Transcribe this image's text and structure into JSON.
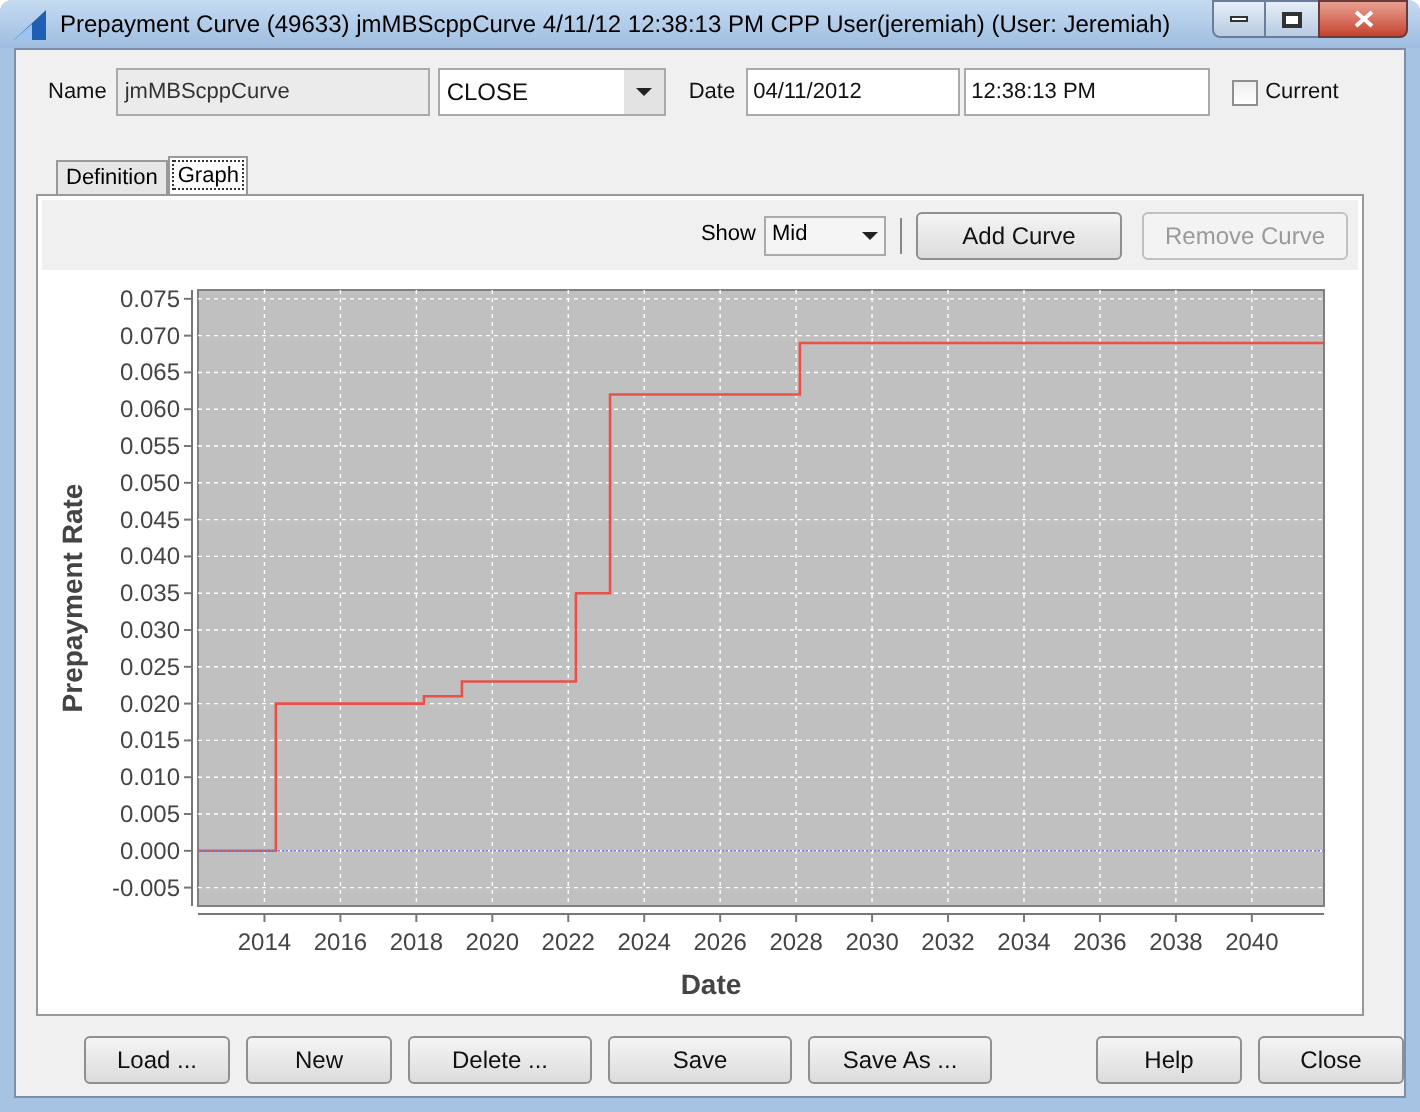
{
  "window": {
    "title": "Prepayment Curve (49633) jmMBScppCurve 4/11/12 12:38:13 PM  CPP User(jeremiah) (User: Jeremiah)"
  },
  "form": {
    "name_label": "Name",
    "name_value": "jmMBScppCurve",
    "mode": "CLOSE",
    "date_label": "Date",
    "date_value": "04/11/2012",
    "time_value": "12:38:13 PM",
    "current": {
      "label": "Current",
      "checked": false
    }
  },
  "tabs": [
    {
      "label": "Definition",
      "selected": false
    },
    {
      "label": "Graph",
      "selected": true
    }
  ],
  "toolbar": {
    "show_label": "Show",
    "show_value": "Mid",
    "buttons": [
      {
        "label": "Add Curve",
        "disabled": false
      },
      {
        "label": "Remove Curve",
        "disabled": true
      }
    ]
  },
  "chart_data": {
    "type": "line",
    "grid": true,
    "xlabel": "Date",
    "ylabel": "Prepayment Rate",
    "xlim": [
      2012.25,
      2041.9
    ],
    "ylim": [
      -0.0075,
      0.0762
    ],
    "xticks": [
      2014,
      2016,
      2018,
      2020,
      2022,
      2024,
      2026,
      2028,
      2030,
      2032,
      2034,
      2036,
      2038,
      2040
    ],
    "yticks": [
      {
        "value": 0.075,
        "label": "0.075"
      },
      {
        "value": 0.07,
        "label": "0.070"
      },
      {
        "value": 0.065,
        "label": "0.065"
      },
      {
        "value": 0.06,
        "label": "0.060"
      },
      {
        "value": 0.055,
        "label": "0.055"
      },
      {
        "value": 0.05,
        "label": "0.050"
      },
      {
        "value": 0.045,
        "label": "0.045"
      },
      {
        "value": 0.04,
        "label": "0.040"
      },
      {
        "value": 0.035,
        "label": "0.035"
      },
      {
        "value": 0.03,
        "label": "0.030"
      },
      {
        "value": 0.025,
        "label": "0.025"
      },
      {
        "value": 0.02,
        "label": "0.020"
      },
      {
        "value": 0.015,
        "label": "0.015"
      },
      {
        "value": 0.01,
        "label": "0.010"
      },
      {
        "value": 0.005,
        "label": "0.005"
      },
      {
        "value": 0,
        "label": "0.000"
      },
      {
        "value": -0.005,
        "label": "-0.005"
      }
    ],
    "x": [
      2012.25,
      2014.3,
      2014.3,
      2018.2,
      2018.2,
      2019.2,
      2019.2,
      2022.2,
      2022.2,
      2023.1,
      2023.1,
      2028.1,
      2028.1,
      2041.9
    ],
    "series": [
      {
        "color": "#e8504a",
        "line_style": "solid",
        "values": [
          0,
          0,
          0.02,
          0.02,
          0.021,
          0.021,
          0.023,
          0.023,
          0.035,
          0.035,
          0.062,
          0.062,
          0.069,
          0.069
        ]
      },
      {
        "color": "#7a7ae0",
        "line_style": "dotted",
        "values": [
          0,
          0,
          0,
          0,
          0,
          0,
          0,
          0,
          0,
          0,
          0,
          0,
          0,
          0
        ]
      }
    ]
  },
  "buttons_left": [
    "Load ...",
    "New",
    "Delete ...",
    "Save",
    "Save As ..."
  ],
  "buttons_right": [
    "Help",
    "Close"
  ]
}
